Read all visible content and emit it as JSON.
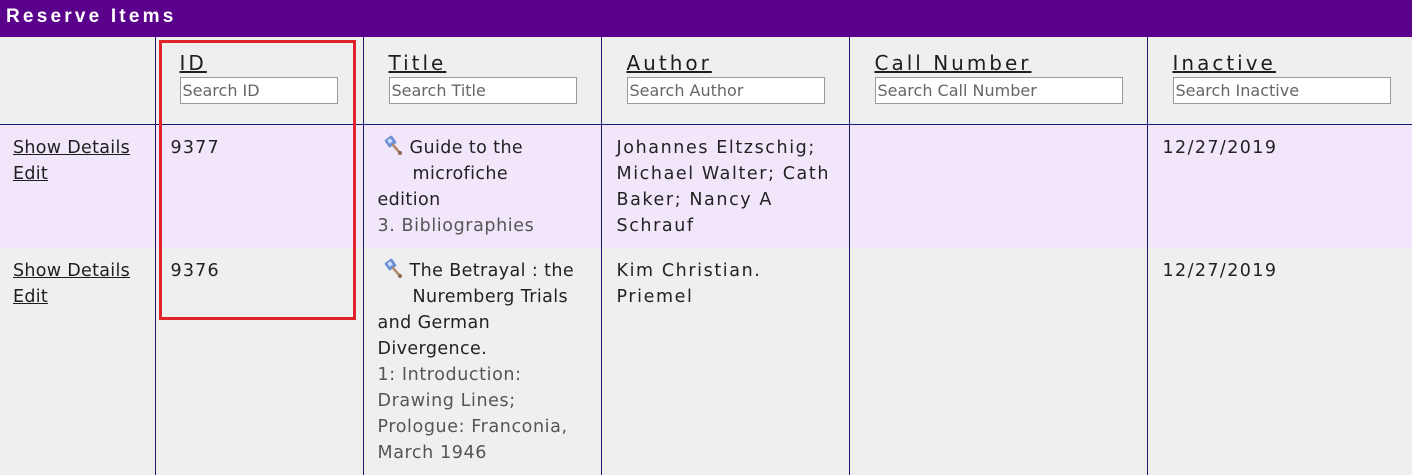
{
  "page": {
    "title": "Reserve Items"
  },
  "columns": [
    {
      "label": "ID",
      "placeholder": "Search ID"
    },
    {
      "label": "Title",
      "placeholder": "Search Title"
    },
    {
      "label": "Author",
      "placeholder": "Search Author"
    },
    {
      "label": "Call Number",
      "placeholder": "Search Call Number"
    },
    {
      "label": "Inactive",
      "placeholder": "Search Inactive"
    }
  ],
  "actions": {
    "show_details": "Show Details",
    "edit": "Edit"
  },
  "rows": [
    {
      "id": "9377",
      "title_line1": "Guide to the",
      "title_line2": "microfiche",
      "title_line3": "edition",
      "title_sub": "3. Bibliographies",
      "author": "Johannes Eltzschig; Michael Walter; Cath Baker; Nancy A Schrauf",
      "call_number": "",
      "inactive": "12/27/2019",
      "item_icon": "reserve-item-icon"
    },
    {
      "id": "9376",
      "title_line1": "The Betrayal : the",
      "title_line2": "Nuremberg Trials",
      "title_line3": "and German Divergence.",
      "title_sub": "1: Introduction: Drawing Lines; Prologue: Franconia, March 1946",
      "author": "Kim Christian. Priemel",
      "call_number": "",
      "inactive": "12/27/2019",
      "item_icon": "reserve-item-icon"
    }
  ],
  "colors": {
    "header_bar": "#5b028c",
    "row_highlight": "#f2e6fb",
    "row_default": "#efefef",
    "grid_line": "#1a1a6e",
    "annotation_box": "#e0242c"
  }
}
